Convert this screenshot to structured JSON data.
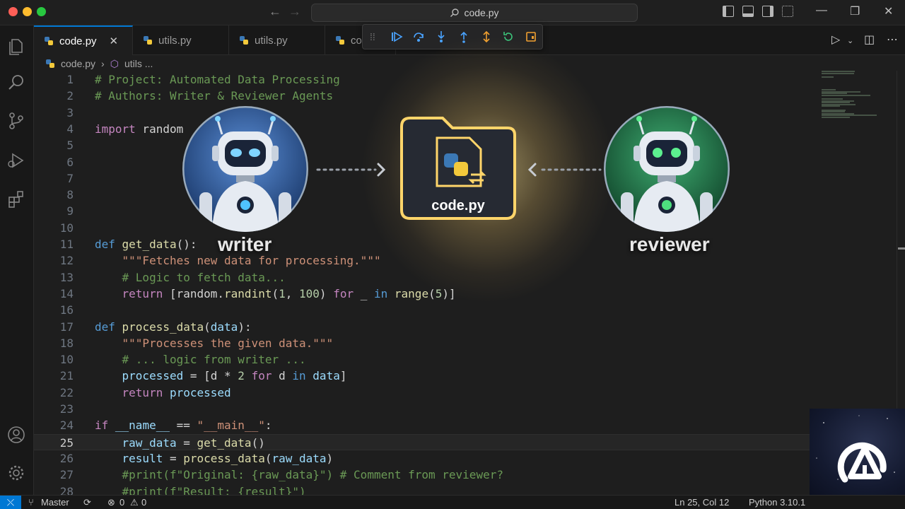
{
  "titlebar": {
    "search_text": "code.py",
    "back_icon": "arrow-left-icon",
    "forward_icon": "arrow-right-icon"
  },
  "tabs": [
    {
      "label": "code.py",
      "active": true,
      "close": "✕"
    },
    {
      "label": "utils.py",
      "active": false
    },
    {
      "label": "utils.py",
      "active": false
    },
    {
      "label": "co",
      "active": false
    }
  ],
  "breadcrumb": {
    "file": "code.py",
    "symbol": "utils ..."
  },
  "code_lines": [
    {
      "n": "1",
      "parts": [
        [
          "c-com",
          "# Project: Automated Data Processing"
        ]
      ]
    },
    {
      "n": "2",
      "parts": [
        [
          "c-com",
          "# Authors: Writer & Reviewer Agents"
        ]
      ]
    },
    {
      "n": "3",
      "parts": []
    },
    {
      "n": "4",
      "parts": [
        [
          "c-kw2",
          "import"
        ],
        [
          "c-def",
          " random"
        ]
      ]
    },
    {
      "n": "5",
      "parts": []
    },
    {
      "n": "6",
      "parts": []
    },
    {
      "n": "7",
      "parts": []
    },
    {
      "n": "8",
      "parts": []
    },
    {
      "n": "9",
      "parts": []
    },
    {
      "n": "10",
      "parts": []
    },
    {
      "n": "11",
      "parts": [
        [
          "c-kw",
          "def"
        ],
        [
          "c-def",
          " "
        ],
        [
          "c-fn",
          "get_data"
        ],
        [
          "c-def",
          "():"
        ]
      ]
    },
    {
      "n": "12",
      "parts": [
        [
          "c-str",
          "    \"\"\"Fetches new data for processing.\"\"\""
        ]
      ]
    },
    {
      "n": "13",
      "parts": [
        [
          "c-com",
          "    # Logic to fetch data..."
        ]
      ]
    },
    {
      "n": "14",
      "parts": [
        [
          "c-kw2",
          "    return"
        ],
        [
          "c-def",
          " [random."
        ],
        [
          "c-fn",
          "randint"
        ],
        [
          "c-def",
          "("
        ],
        [
          "c-num",
          "1"
        ],
        [
          "c-def",
          ", "
        ],
        [
          "c-num",
          "100"
        ],
        [
          "c-def",
          ") "
        ],
        [
          "c-kw2",
          "for"
        ],
        [
          "c-def",
          " _ "
        ],
        [
          "c-kw",
          "in"
        ],
        [
          "c-def",
          " "
        ],
        [
          "c-fn",
          "range"
        ],
        [
          "c-def",
          "("
        ],
        [
          "c-num",
          "5"
        ],
        [
          "c-def",
          ")]"
        ]
      ]
    },
    {
      "n": "16",
      "parts": []
    },
    {
      "n": "17",
      "parts": [
        [
          "c-kw",
          "def"
        ],
        [
          "c-def",
          " "
        ],
        [
          "c-fn",
          "process_data"
        ],
        [
          "c-def",
          "("
        ],
        [
          "c-var",
          "data"
        ],
        [
          "c-def",
          "):"
        ]
      ]
    },
    {
      "n": "18",
      "parts": [
        [
          "c-str",
          "    \"\"\"Processes the given data.\"\"\""
        ]
      ]
    },
    {
      "n": "10",
      "parts": [
        [
          "c-com",
          "    # ... logic from writer ..."
        ]
      ]
    },
    {
      "n": "21",
      "parts": [
        [
          "c-var",
          "    processed"
        ],
        [
          "c-def",
          " = [d * "
        ],
        [
          "c-num",
          "2"
        ],
        [
          "c-def",
          " "
        ],
        [
          "c-kw2",
          "for"
        ],
        [
          "c-def",
          " d "
        ],
        [
          "c-kw",
          "in"
        ],
        [
          "c-def",
          " "
        ],
        [
          "c-var",
          "data"
        ],
        [
          "c-def",
          "]"
        ]
      ]
    },
    {
      "n": "22",
      "parts": [
        [
          "c-kw2",
          "    return"
        ],
        [
          "c-def",
          " "
        ],
        [
          "c-var",
          "processed"
        ]
      ]
    },
    {
      "n": "23",
      "parts": []
    },
    {
      "n": "24",
      "parts": [
        [
          "c-kw2",
          "if"
        ],
        [
          "c-def",
          " "
        ],
        [
          "c-var",
          "__name__"
        ],
        [
          "c-def",
          " == "
        ],
        [
          "c-str",
          "\"__main__\""
        ],
        [
          "c-def",
          ":"
        ]
      ]
    },
    {
      "n": "25",
      "current": true,
      "parts": [
        [
          "c-var",
          "    raw_data"
        ],
        [
          "c-def",
          " = "
        ],
        [
          "c-fn",
          "get_data"
        ],
        [
          "c-def",
          "()"
        ]
      ]
    },
    {
      "n": "26",
      "parts": [
        [
          "c-var",
          "    result"
        ],
        [
          "c-def",
          " = "
        ],
        [
          "c-fn",
          "process_data"
        ],
        [
          "c-def",
          "("
        ],
        [
          "c-var",
          "raw_data"
        ],
        [
          "c-def",
          ")"
        ]
      ]
    },
    {
      "n": "27",
      "parts": [
        [
          "c-com",
          "    #print(f\"Original: {raw_data}\") # Comment from reviewer?"
        ]
      ]
    },
    {
      "n": "28",
      "parts": [
        [
          "c-com",
          "    #print(f\"Result: {result}\")"
        ]
      ]
    }
  ],
  "overlay": {
    "writer_label": "writer",
    "reviewer_label": "reviewer",
    "file_label": "code.py"
  },
  "statusbar": {
    "branch": "Master",
    "problems": "0",
    "warnings": "0",
    "position": "Ln 25, Col 12",
    "language": "Python 3.10.1"
  },
  "colors": {
    "accent": "#0078d4",
    "writer": "#3a7bd5",
    "reviewer": "#2fbf71",
    "glow": "#ffd56a"
  }
}
